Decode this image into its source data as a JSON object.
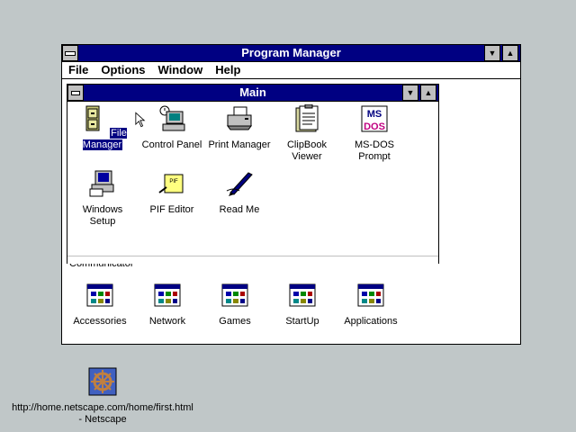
{
  "program_manager": {
    "title": "Program Manager",
    "menus": [
      "File",
      "Options",
      "Window",
      "Help"
    ]
  },
  "main_group": {
    "title": "Main",
    "icons": [
      {
        "label": "File Manager",
        "icon": "file-cabinet-icon",
        "selected": true
      },
      {
        "label": "Control Panel",
        "icon": "control-panel-icon"
      },
      {
        "label": "Print Manager",
        "icon": "printer-icon"
      },
      {
        "label": "ClipBook Viewer",
        "icon": "clipbook-icon"
      },
      {
        "label": "MS-DOS Prompt",
        "icon": "msdos-icon"
      },
      {
        "label": "Windows Setup",
        "icon": "windows-setup-icon"
      },
      {
        "label": "PIF Editor",
        "icon": "pif-editor-icon"
      },
      {
        "label": "Read Me",
        "icon": "read-me-icon"
      }
    ]
  },
  "partially_hidden_label": "Communicator",
  "group_icons": [
    {
      "label": "Accessories",
      "icon": "program-group-icon"
    },
    {
      "label": "Network",
      "icon": "program-group-icon"
    },
    {
      "label": "Games",
      "icon": "program-group-icon"
    },
    {
      "label": "StartUp",
      "icon": "program-group-icon"
    },
    {
      "label": "Applications",
      "icon": "program-group-icon"
    }
  ],
  "desktop_icon": {
    "line1": "http://home.netscape.com/home/first.html",
    "line2": "- Netscape",
    "icon": "netscape-wheel-icon"
  },
  "colors": {
    "titlebar": "#000082",
    "desktop": "#c0c7c8",
    "chrome": "#c0c0c0"
  }
}
